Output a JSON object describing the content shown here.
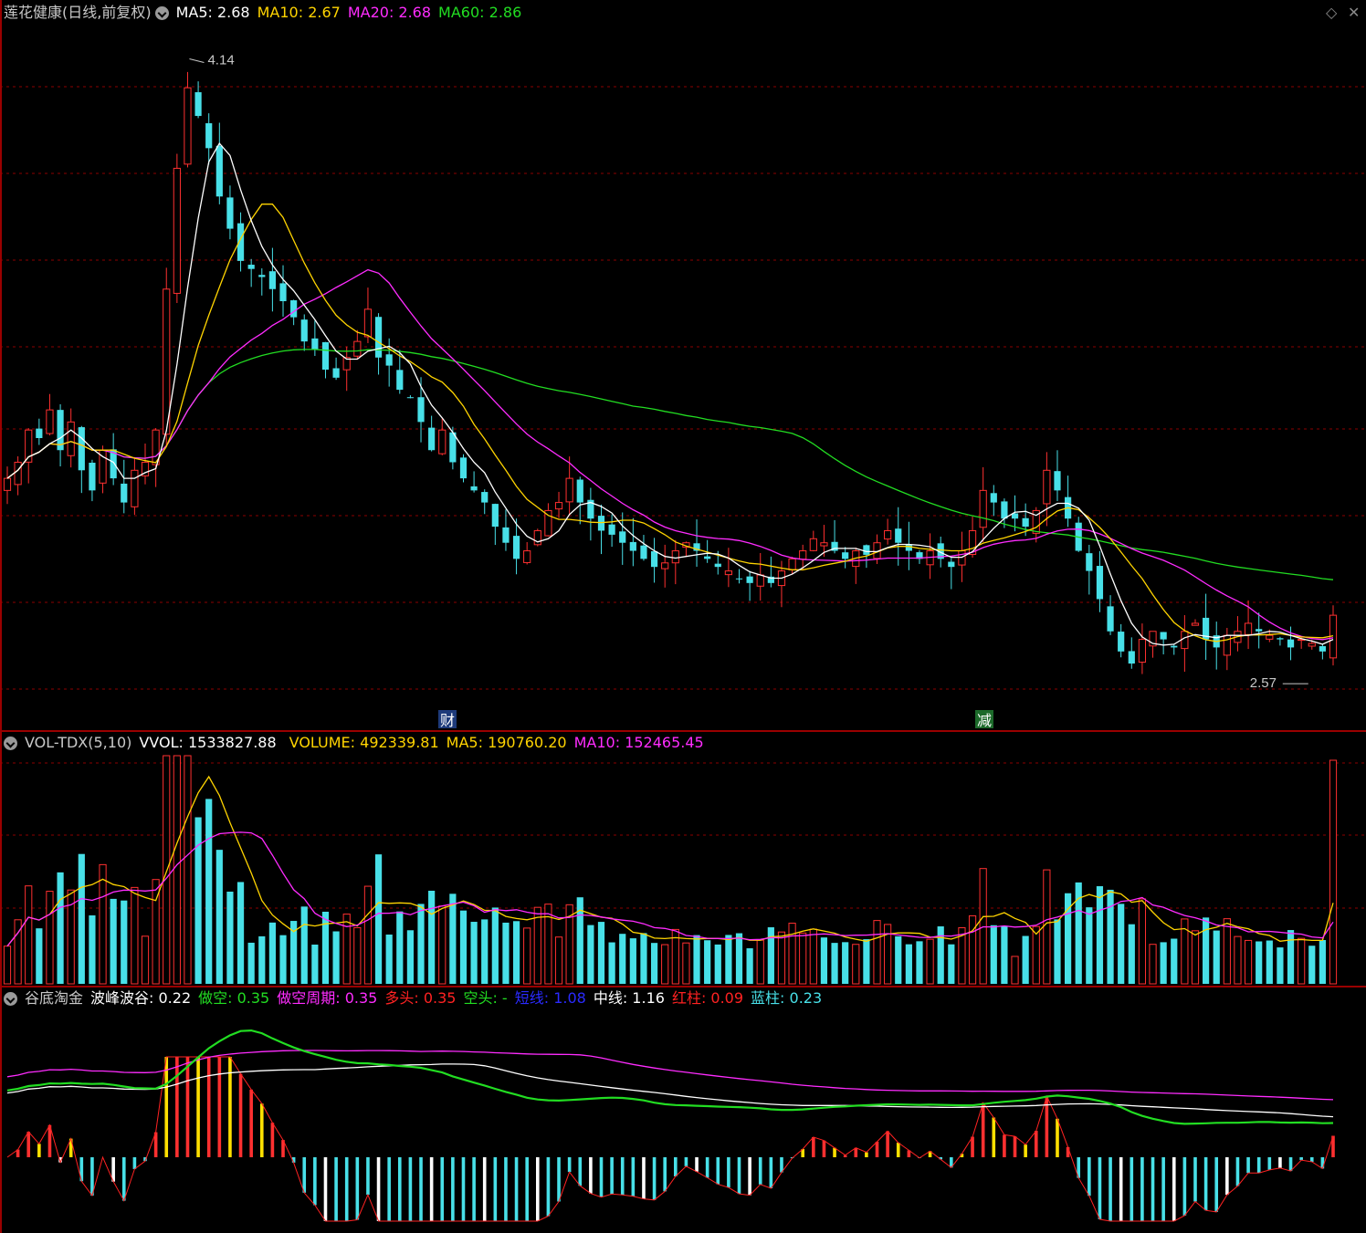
{
  "main": {
    "stock_name": "莲花健康(日线,前复权)",
    "indicators": [
      {
        "label": "MA5: 2.68",
        "color": "#ffffff"
      },
      {
        "label": "MA10: 2.67",
        "color": "#ffd400"
      },
      {
        "label": "MA20: 2.68",
        "color": "#ff2cff"
      },
      {
        "label": "MA60: 2.86",
        "color": "#22dd22"
      }
    ],
    "high_label": "4.14",
    "low_label": "2.57",
    "marker_cai": "财",
    "marker_jian": "减",
    "corner_icons": [
      "diamond-icon",
      "close-icon"
    ]
  },
  "vol": {
    "name": "VOL-TDX(5,10)",
    "indicators": [
      {
        "label": "VVOL: 1533827.88",
        "color": "#ffffff"
      },
      {
        "label": "VOLUME: 492339.81",
        "color": "#ffd400"
      },
      {
        "label": "MA5: 190760.20",
        "color": "#ffd400"
      },
      {
        "label": "MA10: 152465.45",
        "color": "#ff2cff"
      }
    ]
  },
  "ind": {
    "name": "谷底淘金",
    "indicators": [
      {
        "label": "波峰波谷: 0.22",
        "color": "#ffffff"
      },
      {
        "label": "做空: 0.35",
        "color": "#22dd22"
      },
      {
        "label": "做空周期: 0.35",
        "color": "#ff2cff"
      },
      {
        "label": "多头: 0.35",
        "color": "#ff2222"
      },
      {
        "label": "空头: -",
        "color": "#22dd22"
      },
      {
        "label": "短线: 1.08",
        "color": "#2a2aff"
      },
      {
        "label": "中线: 1.16",
        "color": "#ffffff"
      },
      {
        "label": "红柱: 0.09",
        "color": "#ff2222"
      },
      {
        "label": "蓝柱: 0.23",
        "color": "#48e0e8"
      }
    ]
  },
  "colors": {
    "up": "#ff3030",
    "down": "#48e0e8",
    "grid": "#8b0000",
    "ma5": "#ffffff",
    "ma10": "#ffd400",
    "ma20": "#ff2cff",
    "ma60": "#22dd22"
  },
  "chart_data": {
    "type": "candlestick",
    "title": "莲花健康(日线,前复权)",
    "price_range": [
      2.5,
      4.2
    ],
    "price_high": 4.14,
    "price_low": 2.57,
    "closes": [
      3.08,
      3.12,
      3.2,
      3.18,
      3.25,
      3.15,
      3.22,
      3.1,
      3.05,
      3.15,
      3.08,
      3.02,
      3.1,
      3.12,
      3.2,
      3.55,
      3.85,
      4.05,
      3.98,
      3.9,
      3.78,
      3.7,
      3.62,
      3.6,
      3.58,
      3.55,
      3.52,
      3.48,
      3.42,
      3.4,
      3.35,
      3.33,
      3.38,
      3.42,
      3.5,
      3.38,
      3.36,
      3.3,
      3.28,
      3.22,
      3.15,
      3.2,
      3.12,
      3.08,
      3.05,
      3.02,
      2.96,
      2.92,
      2.88,
      2.9,
      2.95,
      3.0,
      3.02,
      3.08,
      3.02,
      2.98,
      2.95,
      2.94,
      2.92,
      2.9,
      2.88,
      2.86,
      2.87,
      2.9,
      2.92,
      2.9,
      2.88,
      2.86,
      2.85,
      2.83,
      2.82,
      2.84,
      2.82,
      2.85,
      2.88,
      2.9,
      2.93,
      2.92,
      2.9,
      2.88,
      2.9,
      2.89,
      2.92,
      2.95,
      2.92,
      2.9,
      2.88,
      2.9,
      2.88,
      2.86,
      2.9,
      2.95,
      3.05,
      3.02,
      2.98,
      2.98,
      2.96,
      3.0,
      3.1,
      3.05,
      2.98,
      2.9,
      2.85,
      2.78,
      2.7,
      2.65,
      2.62,
      2.68,
      2.7,
      2.68,
      2.66,
      2.7,
      2.72,
      2.68,
      2.66,
      2.69,
      2.7,
      2.72,
      2.7,
      2.69,
      2.68,
      2.66,
      2.68,
      2.67,
      2.65,
      2.74
    ]
  }
}
